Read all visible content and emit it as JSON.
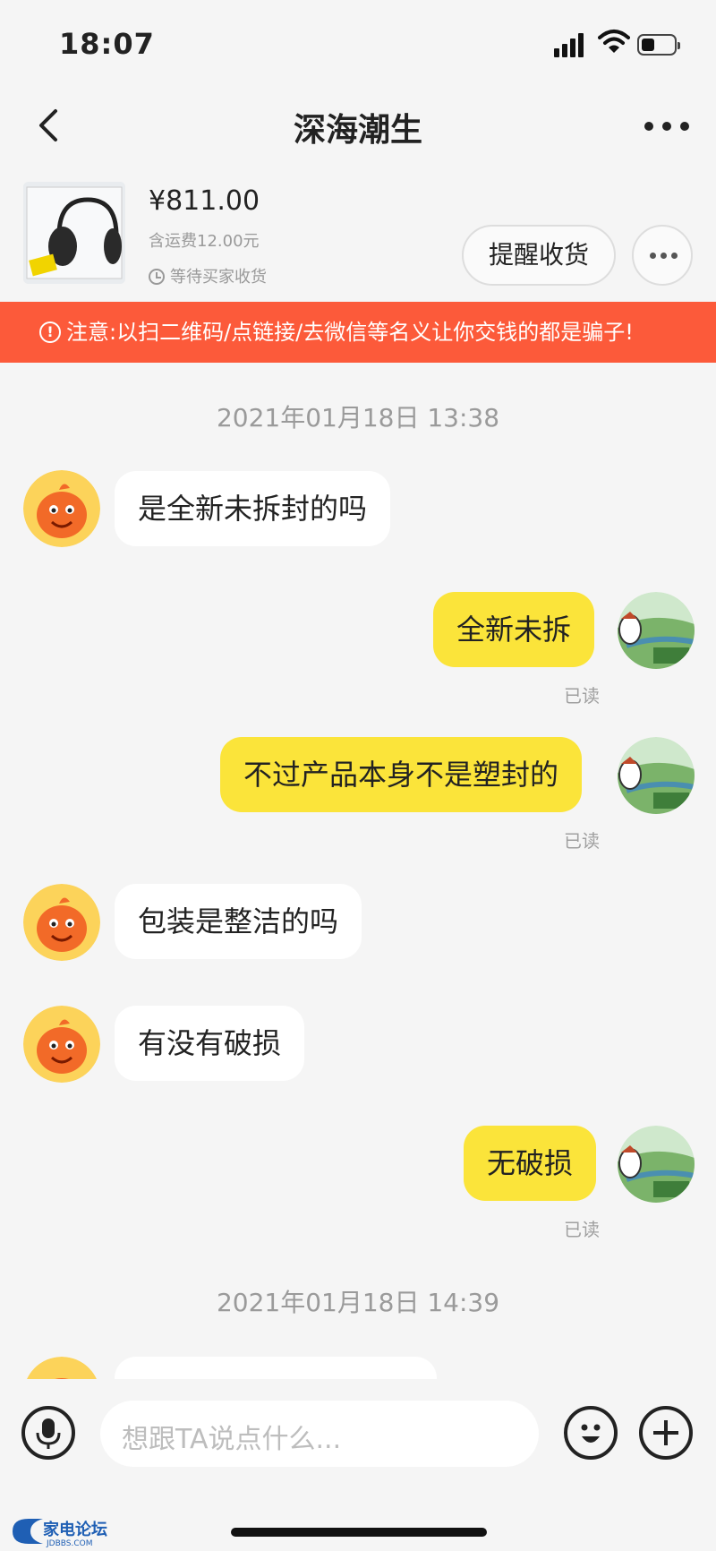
{
  "status_bar": {
    "time": "18:07"
  },
  "nav": {
    "title": "深海潮生"
  },
  "product": {
    "price": "¥811.00",
    "shipping": "含运费12.00元",
    "status": "等待买家收货",
    "remind_label": "提醒收货"
  },
  "warning": {
    "text": "注意:以扫二维码/点链接/去微信等名义让你交钱的都是骗子!"
  },
  "chat": {
    "timestamp1": "2021年01月18日 13:38",
    "timestamp2": "2021年01月18日 14:39",
    "read_label": "已读",
    "messages": [
      {
        "side": "in",
        "text": "是全新未拆封的吗"
      },
      {
        "side": "out",
        "text": "全新未拆"
      },
      {
        "side": "out",
        "text": "不过产品本身不是塑封的"
      },
      {
        "side": "in",
        "text": "包装是整洁的吗"
      },
      {
        "side": "in",
        "text": "有没有破损"
      },
      {
        "side": "out",
        "text": "无破损"
      }
    ]
  },
  "input": {
    "placeholder": "想跟TA说点什么..."
  },
  "watermark": {
    "text": "家电论坛",
    "subtext": "JDBBS.COM"
  },
  "colors": {
    "accent_yellow": "#fbe43a",
    "warning_bg": "#fc5a3a",
    "bg": "#f5f5f5"
  },
  "icons": [
    "back-icon",
    "more-icon",
    "signal-icon",
    "wifi-icon",
    "battery-icon",
    "clock-icon",
    "alert-icon",
    "mic-icon",
    "emoji-icon",
    "plus-icon"
  ]
}
